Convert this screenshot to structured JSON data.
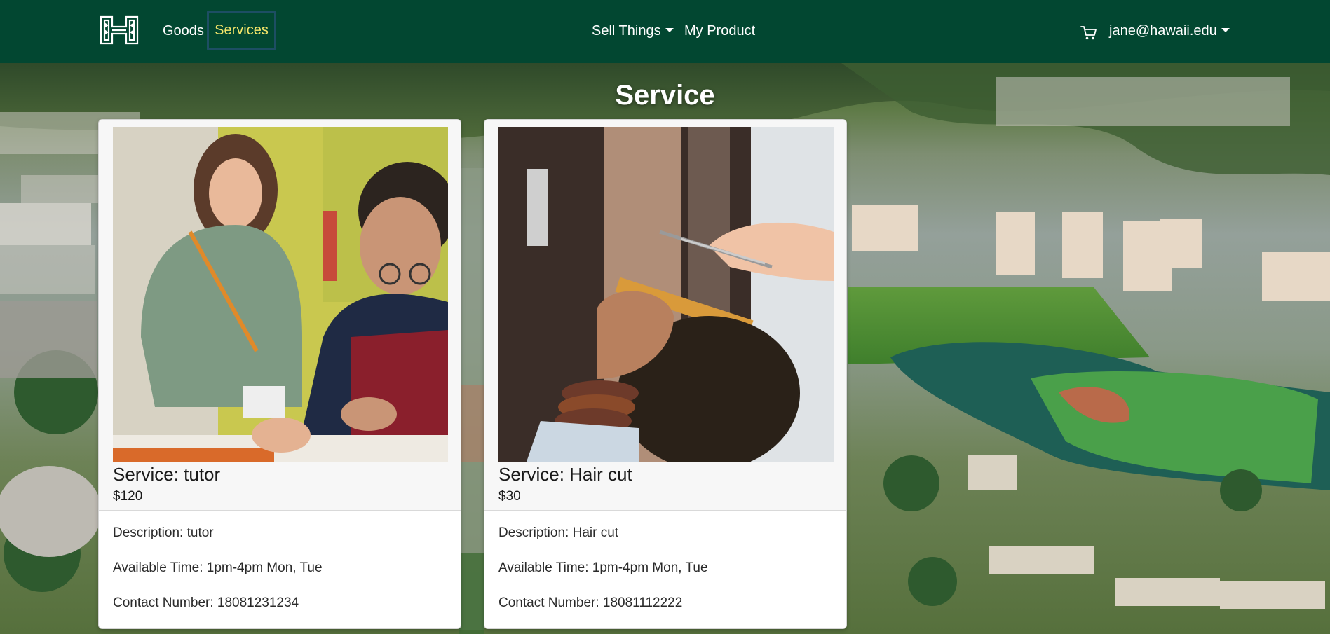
{
  "navbar": {
    "logo_icon": "hawaii-h-logo-icon",
    "links": {
      "goods": "Goods",
      "services": "Services",
      "sell_things": "Sell Things",
      "my_product": "My Product",
      "user": "jane@hawaii.edu"
    },
    "cart_icon": "cart-icon",
    "colors": {
      "background": "#024731",
      "active_link": "#f7e76a",
      "link": "#ffffff"
    }
  },
  "page": {
    "title": "Service"
  },
  "cards": [
    {
      "title": "Service: tutor",
      "price": "$120",
      "description": "Description: tutor",
      "available_time": "Available Time: 1pm-4pm Mon, Tue",
      "contact": "Contact Number: 18081231234",
      "image": "tutoring-photo"
    },
    {
      "title": "Service: Hair cut",
      "price": "$30",
      "description": "Description: Hair cut",
      "available_time": "Available Time: 1pm-4pm Mon, Tue",
      "contact": "Contact Number: 18081112222",
      "image": "haircut-photo"
    }
  ]
}
